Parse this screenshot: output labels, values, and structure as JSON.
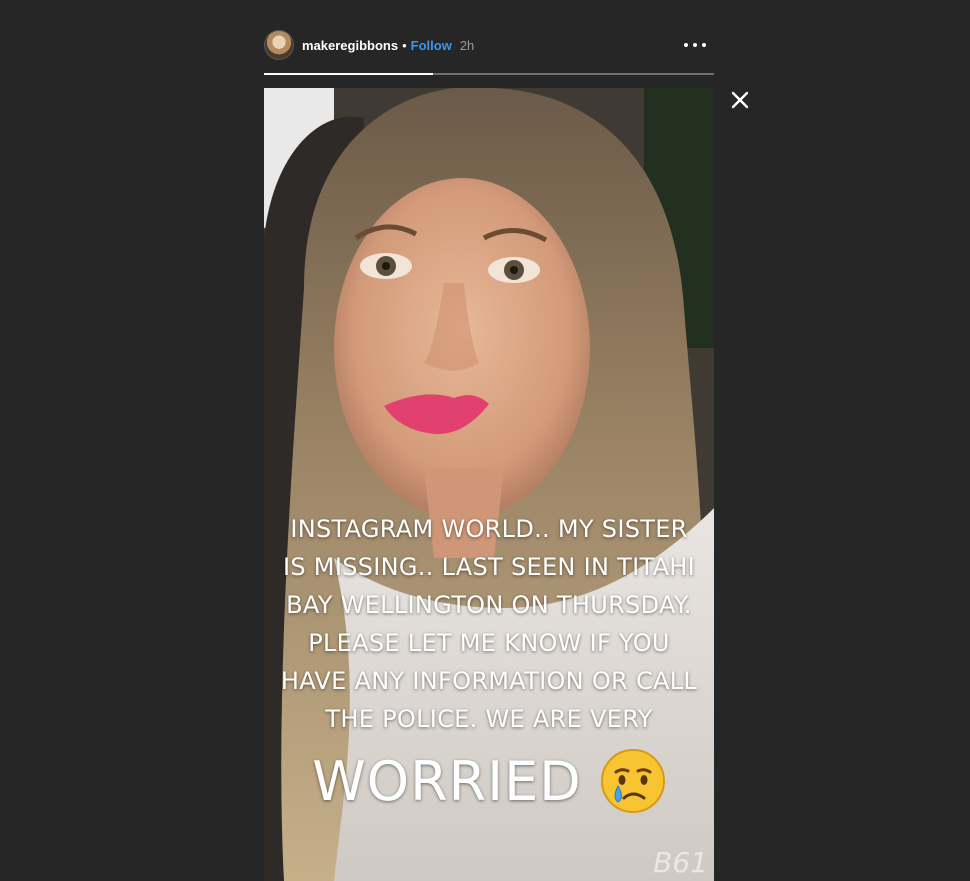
{
  "header": {
    "username": "makeregibbons",
    "separator": "•",
    "follow_label": "Follow",
    "time_ago": "2h",
    "more_icon": "more-horizontal-icon",
    "avatar_icon": "avatar"
  },
  "progress": {
    "fraction": 0.375
  },
  "close_icon": "close-icon",
  "story": {
    "caption_lines": [
      "INSTAGRAM WORLD.. MY SISTER",
      "IS MISSING.. LAST SEEN IN TITAHI",
      "BAY WELLINGTON ON THURSDAY.",
      "PLEASE LET ME KNOW IF YOU",
      "HAVE ANY INFORMATION OR CALL",
      "THE POLICE. WE ARE VERY"
    ],
    "caption_big": "WORRIED",
    "emoji": "crying-face-emoji",
    "watermark": "B61"
  },
  "colors": {
    "background": "#262626",
    "follow": "#3897f0",
    "text": "#ffffff"
  }
}
